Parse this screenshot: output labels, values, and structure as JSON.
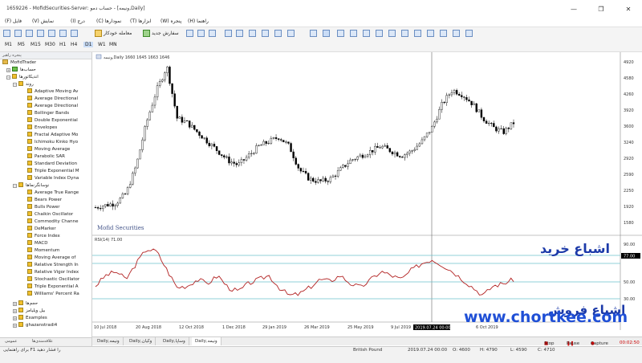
{
  "window": {
    "title": "1659226 - MofidSecurities-Server: حساب دمو - [ونیمه,Daily]",
    "buttons": [
      "—",
      "❐",
      "✕"
    ]
  },
  "menu": {
    "items": [
      "(F) فایل",
      "(V) نمایش",
      "(I) درج",
      "(C) نمودارها",
      "(T) ابزارها",
      "(W) پنجره",
      "(H) راهنما"
    ]
  },
  "toolbar": {
    "new_order": "معامله خودکار",
    "new_order2": "سفارش جدید",
    "timeframes": [
      "M1",
      "M5",
      "M15",
      "M30",
      "H1",
      "H4",
      "D1",
      "W1",
      "MN"
    ]
  },
  "navigator": {
    "header": "پنجره راهبر",
    "root": "MofidTrader",
    "accounts": "حساب‌ها",
    "indicators": "اندیکاتورها",
    "trend_folder": "روند",
    "trend": [
      "Adaptive Moving Av",
      "Average Directional",
      "Average Directional",
      "Bollinger Bands",
      "Double Exponential",
      "Envelopes",
      "Fractal Adaptive Mo",
      "Ichimoku Kinko Hyo",
      "Moving Average",
      "Parabolic SAR",
      "Standard Deviation",
      "Triple Exponential M",
      "Variable Index Dyna"
    ],
    "osc_folder": "نوسانگرنماها",
    "oscillators": [
      "Average True Range",
      "Bears Power",
      "Bulls Power",
      "Chaikin Oscillator",
      "Commodity Channe",
      "DeMarker",
      "Force Index",
      "MACD",
      "Momentum",
      "Moving Average of",
      "Relative Strength In",
      "Relative Vigor Index",
      "Stochastic Oscillator",
      "Triple Exponential A",
      "Williams' Percent Ra"
    ],
    "extra": [
      "حجم‌ها",
      "بیل ویلیامز",
      "Examples",
      "ghazanstradi4"
    ],
    "tabs": [
      "عمومی",
      "علاقه‌مندی‌ها"
    ]
  },
  "chart": {
    "info": "ونیمه,Daily 1660 1645 1663 1646",
    "watermark": "Mofid Securities",
    "rsi_label": "RSI(14) 71.00",
    "price_labels": [
      "4920",
      "4580",
      "4260",
      "3920",
      "3600",
      "3240",
      "2920",
      "2590",
      "2250",
      "1920",
      "1580"
    ],
    "rsi_levels": [
      "90.00",
      "70.00",
      "50.00",
      "30.00"
    ],
    "rsi_current": "77.00",
    "dates": [
      "10 Jul 2018",
      "20 Aug 2018",
      "12 Oct 2018",
      "1 Dec 2018",
      "29 Jan 2019",
      "26 Mar 2019",
      "25 May 2019",
      "9 Jul 2019",
      "2019.07.24 00:00",
      "6 Oct 2019"
    ],
    "crosshair_label": "2019.07.24 00:00",
    "overbought_text": "اشباع خرید",
    "oversold_text": "اشباع فروش",
    "site_text": "www.chortkee.com",
    "colors": {
      "candle": "#000000",
      "rsi": "#b22222",
      "level": "#5fb9c4",
      "overlay_blue": "#1c3aa9",
      "site": "#1f4fd6"
    },
    "chart_data": {
      "type": "line",
      "series": [
        {
          "values": [
            1700,
            1750,
            1790,
            2000,
            2600,
            3500,
            4200,
            4700,
            3600,
            3500,
            3300,
            3100,
            2900,
            2700,
            2600,
            2800,
            3000,
            3100,
            3200,
            3000,
            2500,
            2300,
            2250,
            2300,
            2500,
            2700,
            2800,
            2900,
            3000,
            2900,
            2800,
            2900,
            3100,
            3400,
            3900,
            4200,
            4100,
            3900,
            3600,
            3400,
            3300,
            3500
          ]
        },
        {
          "values": [
            42,
            55,
            60,
            50,
            70,
            88,
            85,
            62,
            40,
            42,
            50,
            45,
            55,
            40,
            35,
            45,
            50,
            55,
            40,
            30,
            32,
            40,
            50,
            48,
            55,
            45,
            40,
            50,
            60,
            55,
            50,
            62,
            70,
            75,
            68,
            60,
            50,
            40,
            30,
            42,
            45,
            50
          ]
        }
      ]
    }
  },
  "chart_tabs": [
    "Daily,ونیمه",
    "Daily,وکیان",
    "Daily,وساپا",
    "Daily,ونیمه"
  ],
  "status": {
    "left": "برای راهنمایی F1 را فشار دهید",
    "profile": "British Pound",
    "datetime": "2019.07.24 00:00",
    "open": "O: 4600",
    "high": "H: 4790",
    "low": "L: 4590",
    "close": "C: 4710",
    "stop": "Stop",
    "pause": "Pause",
    "capture": "Capture",
    "timer": "00:02:50"
  }
}
